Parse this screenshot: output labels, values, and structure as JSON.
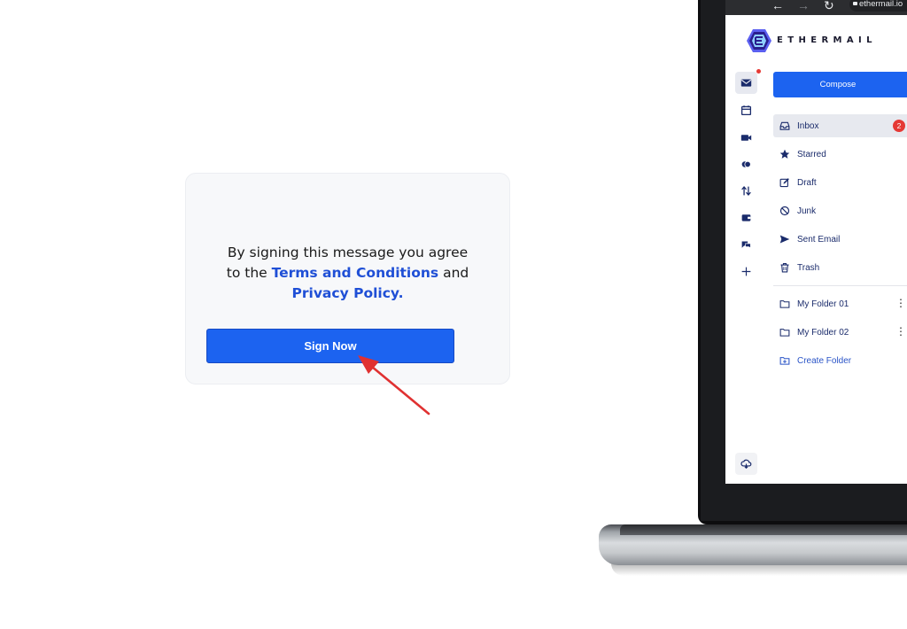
{
  "card": {
    "line1": "By signing this message you agree",
    "line2_prefix": "to the ",
    "terms_link": "Terms and Conditions",
    "line2_suffix": " and",
    "privacy_link": "Privacy Policy.",
    "sign_button": "Sign Now"
  },
  "browser": {
    "url": "ethermail.io"
  },
  "app": {
    "brand": "ETHERMAIL",
    "compose_label": "Compose",
    "folders": [
      {
        "label": "Inbox",
        "icon": "inbox-icon",
        "badge": "2"
      },
      {
        "label": "Starred",
        "icon": "star-icon"
      },
      {
        "label": "Draft",
        "icon": "edit-icon"
      },
      {
        "label": "Junk",
        "icon": "block-icon"
      },
      {
        "label": "Sent Email",
        "icon": "send-icon"
      },
      {
        "label": "Trash",
        "icon": "trash-icon"
      }
    ],
    "custom_folders": [
      {
        "label": "My Folder 01",
        "icon": "folder-icon"
      },
      {
        "label": "My Folder 02",
        "icon": "folder-icon"
      }
    ],
    "create_folder": "Create Folder"
  },
  "colors": {
    "accent": "#1c63f0",
    "link": "#1f4fd6",
    "badge": "#e53935",
    "annotation_arrow": "#e03131"
  }
}
